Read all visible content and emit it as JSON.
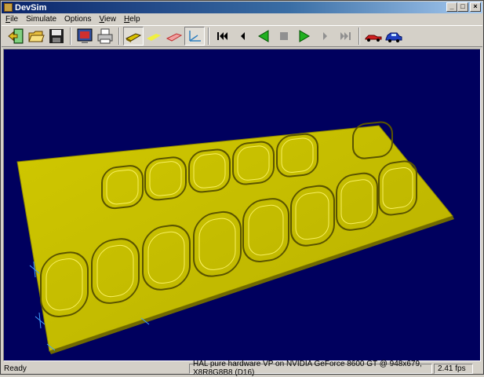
{
  "window": {
    "title": "DevSim"
  },
  "menu": [
    {
      "label": "File",
      "accel": "F",
      "rest": "ile"
    },
    {
      "label": "Simulate",
      "accel": "",
      "rest": "Simulate"
    },
    {
      "label": "Options",
      "accel": "",
      "rest": "Options"
    },
    {
      "label": "View",
      "accel": "V",
      "rest": "iew"
    },
    {
      "label": "Help",
      "accel": "H",
      "rest": "elp"
    }
  ],
  "toolbar": {
    "icons": [
      "exit-icon",
      "open-folder-icon",
      "save-disk-icon",
      "monitor-icon",
      "printer-icon",
      "solid-part-icon",
      "flat-part-icon",
      "wire-part-icon",
      "axes-icon",
      "rewind-icon",
      "step-back-icon",
      "play-reverse-icon",
      "stop-icon",
      "play-icon",
      "step-forward-icon",
      "fast-forward-icon",
      "race-car-icon",
      "car-icon"
    ]
  },
  "status": {
    "ready": "Ready",
    "renderer": "HAL pure hardware VP on NVIDIA GeForce 8600 GT @ 948x679, X8R8G8B8 (D16)",
    "fps": "2.41 fps"
  },
  "colors": {
    "viewport_bg": "#00005e",
    "part": "#d8d000",
    "titlebar": "#0a246a"
  }
}
